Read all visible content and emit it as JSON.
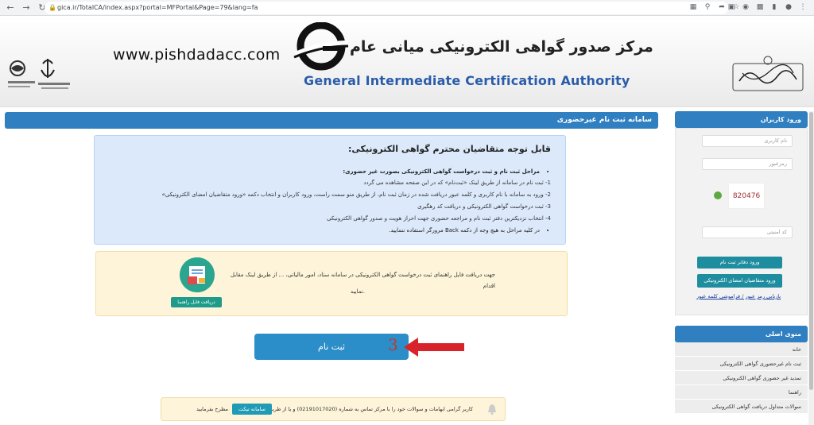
{
  "browser": {
    "url": "gica.ir/TotalCA/index.aspx?portal=MFPortal&Page=79&lang=fa",
    "back_icon": "back-arrow-icon",
    "forward_icon": "forward-arrow-icon",
    "reload_icon": "reload-icon"
  },
  "header": {
    "site_url": "www.pishdadacc.com",
    "title_fa": "مرکز صدور گواهی الکترونیکی میانی عام",
    "title_en": "General Intermediate Certification Authority"
  },
  "main": {
    "bar_title": "سامانه ثبت نام غیرحضوری",
    "notice": {
      "heading": "قابل توجه متقاضیان محترم گواهی الکترونیکی:",
      "steps_title": "مراحل ثبت نام و ثبت درخواست گواهی الکترونیکی بصورت غیر حضوری:",
      "steps": [
        "1- ثبت نام در سامانه از طریق لینک «ثبت‌نام» که در این صفحه مشاهده می گردد",
        "2- ورود به سامانه با نام کاربری و کلمه عبور دریافت شده در زمان ثبت نام، از طریق منو سمت راست، ورود کاربران و انتخاب دکمه «ورود متقاضیان امضای الکترونیکی»",
        "3- ثبت درخواست گواهی الکترونیکی و دریافت کد رهگیری",
        "4- انتخاب نزدیکترین دفتر ثبت نام و مراجعه حضوری جهت احراز هویت و صدور گواهی الکترونیکی"
      ],
      "footer_note": "در کلیه مراحل به هیچ وجه از دکمه Back مرورگر استفاده ننمایید."
    },
    "guide": {
      "text": "جهت دریافت فایل راهنمای ثبت درخواست گواهی الکترونیکی در سامانه ستاد، امور مالیاتی، ... از طریق لینک مقابل اقدام",
      "text2": "نمایید.",
      "button": "دریافت فایل راهنما"
    },
    "register_button": "ثبت نام",
    "annotation_number": "3",
    "bottom_note": {
      "text": "کاربر گرامی ابهامات و سوالات خود را با مرکز تماس به شماره (02191017020) و یا از طریق ثبت در",
      "button": "سامانه تیکت",
      "text2": "مطرح بفرمایید"
    }
  },
  "sidebar": {
    "login_title": "ورود کاربران",
    "username_placeholder": "نام کاربری",
    "password_placeholder": "رمزعبور",
    "captcha_text": "820476",
    "security_code_placeholder": "کد امنیتی",
    "office_login_button": "ورود دفاتر ثبت نام",
    "applicant_login_button": "ورود متقاضیان امضای الکترونیکی",
    "forgot_link": "بازیابی رمز عبور / فراموشی کلمه عبور",
    "menu_title": "منوی اصلی",
    "menu_items": [
      "خانه",
      "ثبت نام غیرحضوری گواهی الکترونیکی",
      "تمدید غیر حضوری گواهی الکترونیکی",
      "راهنما",
      "سوالات متداول دریافت گواهی الکترونیکی"
    ]
  },
  "colors": {
    "primary_blue": "#2f7fc1",
    "notice_bg": "#dbe9fb",
    "guide_bg": "#fdf4d9",
    "teal": "#1f8da0",
    "annotation_red": "#c0392b"
  }
}
